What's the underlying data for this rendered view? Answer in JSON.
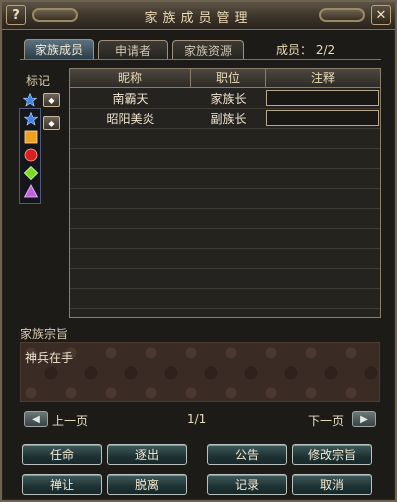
{
  "window": {
    "title": "家族成员管理",
    "help_label": "?",
    "close_label": "✕"
  },
  "tabs": [
    {
      "label": "家族成员",
      "active": true
    },
    {
      "label": "申请者",
      "active": false
    },
    {
      "label": "家族资源",
      "active": false
    }
  ],
  "member_count": "成员： 2/2",
  "marks": {
    "label": "标记",
    "icons": [
      "blue-star-icon",
      "orange-square-icon",
      "red-circle-icon",
      "green-diamond-icon",
      "purple-triangle-icon"
    ]
  },
  "table": {
    "headers": {
      "name": "昵称",
      "position": "职位",
      "note": "注释"
    },
    "rows": [
      {
        "name": "南霸天",
        "position": "家族长",
        "note": ""
      },
      {
        "name": "昭阳美炎",
        "position": "副族长",
        "note": ""
      }
    ]
  },
  "purpose": {
    "label": "家族宗旨",
    "text": "神兵在手"
  },
  "pagination": {
    "prev": "上一页",
    "next": "下一页",
    "page": "1/1"
  },
  "buttons": {
    "appoint": "任命",
    "expel": "逐出",
    "announce": "公告",
    "edit_purpose": "修改宗旨",
    "abdicate": "禅让",
    "leave": "脱离",
    "log": "记录",
    "cancel": "取消"
  }
}
